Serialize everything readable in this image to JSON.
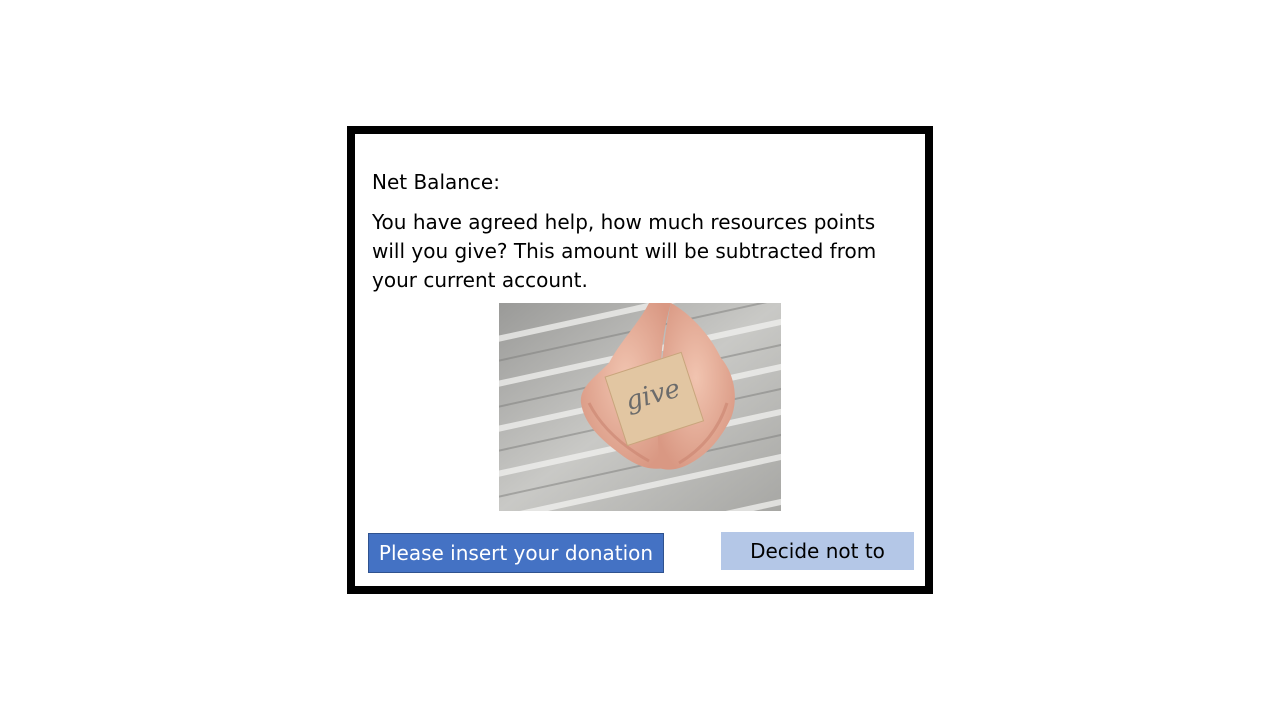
{
  "dialog": {
    "net_balance_label": "Net Balance:",
    "question": "You have agreed help, how much resources points will you give? This amount will be subtracted from your current account.",
    "image": {
      "note_text": "give"
    },
    "buttons": {
      "donate_label": "Please insert your donation",
      "decline_label": "Decide not to"
    }
  },
  "colors": {
    "donate_button": "#4472c4",
    "decline_button": "#b4c7e7",
    "frame": "#000000"
  }
}
